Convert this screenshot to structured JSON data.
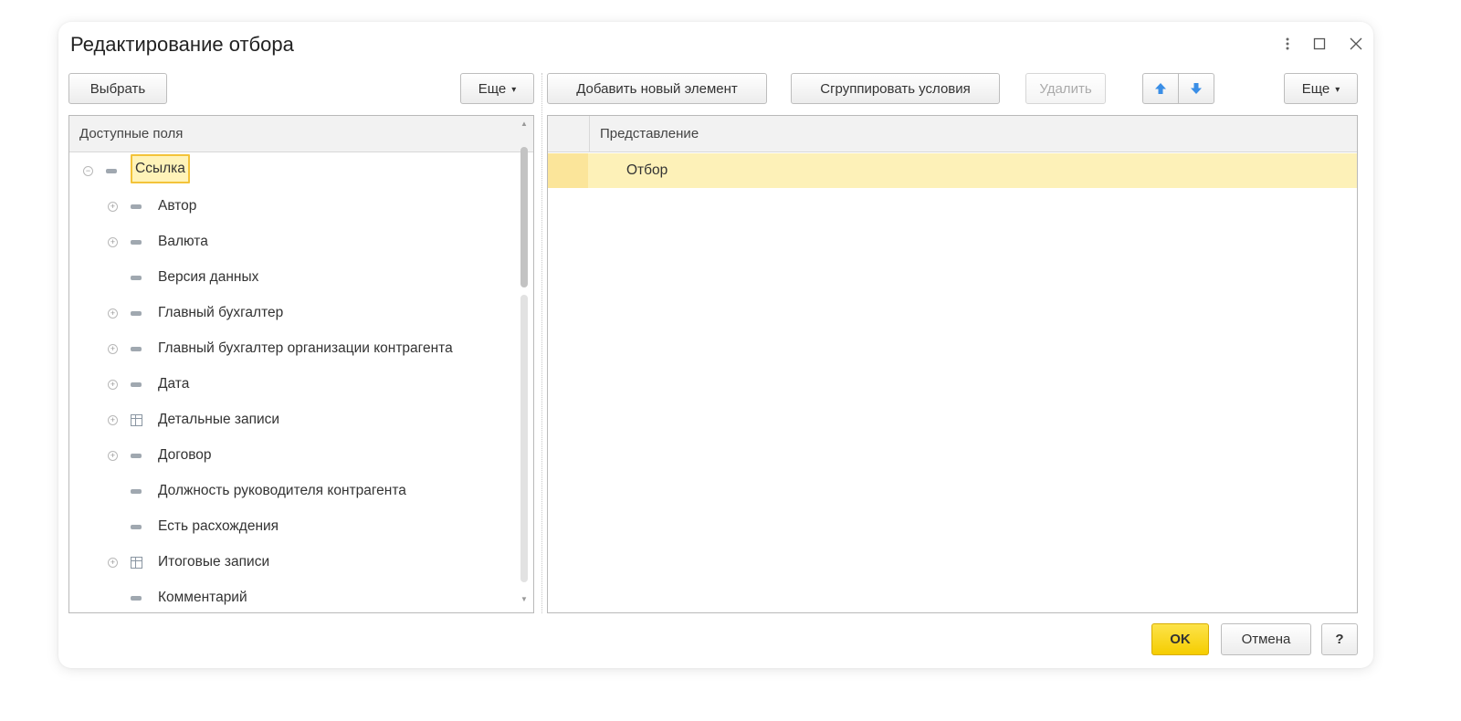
{
  "window": {
    "title": "Редактирование отбора"
  },
  "left_toolbar": {
    "select_label": "Выбрать",
    "more_label": "Еще"
  },
  "right_toolbar": {
    "add_label": "Добавить новый элемент",
    "group_label": "Сгруппировать условия",
    "delete_label": "Удалить",
    "more_label": "Еще"
  },
  "fields_panel": {
    "header": "Доступные поля",
    "items": [
      {
        "label": "Ссылка",
        "expander": "minus",
        "icon": "dash-icon",
        "level": 0,
        "selected": true
      },
      {
        "label": "Автор",
        "expander": "plus",
        "icon": "dash-icon",
        "level": 1
      },
      {
        "label": "Валюта",
        "expander": "plus",
        "icon": "dash-icon",
        "level": 1
      },
      {
        "label": "Версия данных",
        "expander": "none",
        "icon": "dash-icon",
        "level": 1
      },
      {
        "label": "Главный бухгалтер",
        "expander": "plus",
        "icon": "dash-icon",
        "level": 1
      },
      {
        "label": "Главный бухгалтер организации контрагента",
        "expander": "plus",
        "icon": "dash-icon",
        "level": 1
      },
      {
        "label": "Дата",
        "expander": "plus",
        "icon": "dash-icon",
        "level": 1
      },
      {
        "label": "Детальные записи",
        "expander": "plus",
        "icon": "table-icon",
        "level": 1
      },
      {
        "label": "Договор",
        "expander": "plus",
        "icon": "dash-icon",
        "level": 1
      },
      {
        "label": "Должность руководителя контрагента",
        "expander": "none",
        "icon": "dash-icon",
        "level": 1
      },
      {
        "label": "Есть расхождения",
        "expander": "none",
        "icon": "dash-icon",
        "level": 1
      },
      {
        "label": "Итоговые записи",
        "expander": "plus",
        "icon": "table-icon",
        "level": 1
      },
      {
        "label": "Комментарий",
        "expander": "none",
        "icon": "dash-icon",
        "level": 1
      }
    ]
  },
  "filter_panel": {
    "header": "Представление",
    "rows": [
      {
        "label": "Отбор",
        "selected": true
      }
    ]
  },
  "footer": {
    "ok_label": "OK",
    "cancel_label": "Отмена",
    "help_label": "?"
  },
  "colors": {
    "accent_yellow": "#f5cd00",
    "selection_bg": "#fff3b8",
    "arrow_blue": "#3a8ee6"
  }
}
